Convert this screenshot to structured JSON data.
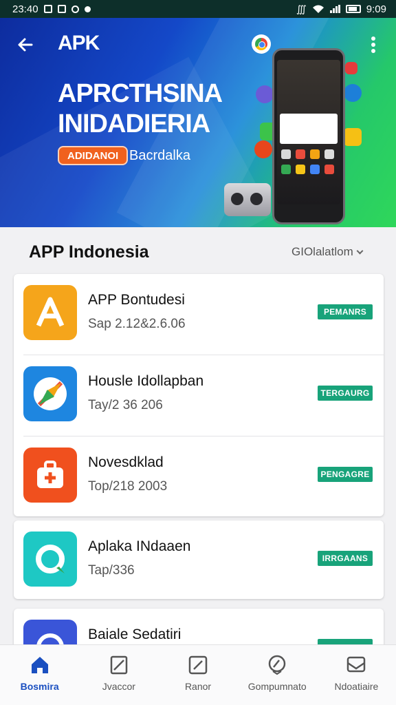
{
  "status_bar": {
    "time": "23:40",
    "left_icons": [
      "alarm-icon",
      "notification-icon",
      "sync-icon",
      "dot-icon"
    ],
    "right_text": "9:09",
    "right_icons": [
      "bluetooth-icon",
      "wifi-icon",
      "signal-icon",
      "battery-icon"
    ]
  },
  "header": {
    "brand": "APK",
    "back_icon": "arrow-left-icon",
    "menu_icon": "more-vertical-icon",
    "badge_icon": "chrome-icon"
  },
  "hero": {
    "title_line1": "APRCTHSINA",
    "title_line2": "INIDADIERIA",
    "pill_label": "ADIDANOI",
    "subtitle": "Bacrdalka"
  },
  "section": {
    "title": "APP Indonesia",
    "filter_label": "GIOlalatlom"
  },
  "apps": [
    {
      "name": "APP Bontudesi",
      "meta": "Sap 2.12&2.6.06",
      "action": "PEMANRS",
      "icon": "letter-a-icon",
      "color": "#f5a51b"
    },
    {
      "name": "Housle Idollapban",
      "meta": "Tay/2 36 206",
      "action": "TERGAURG",
      "icon": "compass-icon",
      "color": "#1e86e0"
    },
    {
      "name": "Novesdklad",
      "meta": "Top/218 2003",
      "action": "PENGAGRE",
      "icon": "medical-kit-icon",
      "color": "#f0501e"
    },
    {
      "name": "Aplaka INdaaen",
      "meta": "Tap/336",
      "action": "IRRGAANS",
      "icon": "search-ring-icon",
      "color": "#1ec8c4"
    },
    {
      "name": "Baiale Sedatiri",
      "meta": "",
      "action": "",
      "icon": "browser-icon",
      "color": "#3a55d8"
    }
  ],
  "bottom_nav": [
    {
      "label": "Bosmira",
      "icon": "home-icon",
      "active": true
    },
    {
      "label": "Jvaccor",
      "icon": "document-icon",
      "active": false
    },
    {
      "label": "Ranor",
      "icon": "edit-icon",
      "active": false
    },
    {
      "label": "Gompumnato",
      "icon": "compass-badge-icon",
      "active": false
    },
    {
      "label": "Ndoatiaire",
      "icon": "inbox-icon",
      "active": false
    }
  ],
  "colors": {
    "accent": "#1a4fc0",
    "action_green": "#18a37a",
    "status_bar": "#0d2f2a"
  }
}
